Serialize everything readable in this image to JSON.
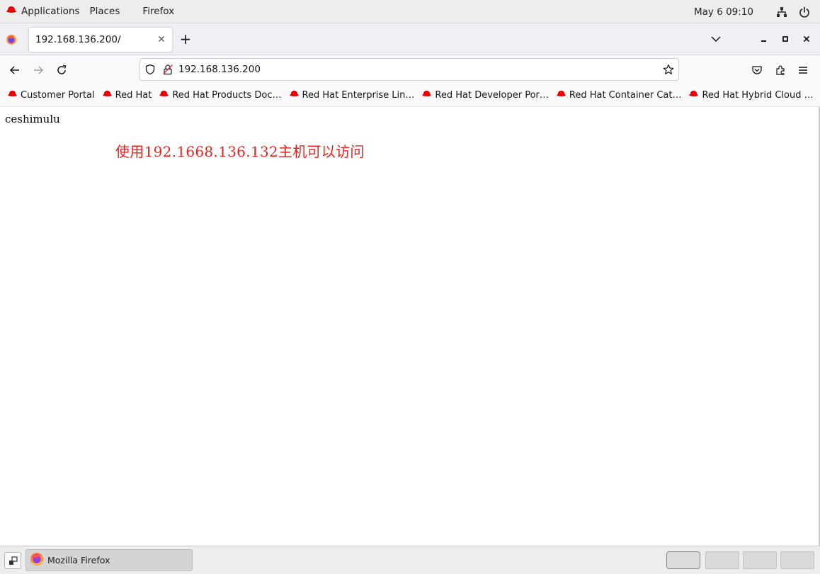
{
  "top_panel": {
    "applications": "Applications",
    "places": "Places",
    "app_name": "Firefox",
    "clock": "May 6  09:10"
  },
  "tabs": [
    {
      "title": "192.168.136.200/"
    }
  ],
  "navbar": {
    "url": "192.168.136.200"
  },
  "bookmarks": [
    {
      "label": "Customer Portal"
    },
    {
      "label": "Red Hat"
    },
    {
      "label": "Red Hat Products Doc…"
    },
    {
      "label": "Red Hat Enterprise Lin…"
    },
    {
      "label": "Red Hat Developer Por…"
    },
    {
      "label": "Red Hat Container Cat…"
    },
    {
      "label": "Red Hat Hybrid Cloud …"
    }
  ],
  "page": {
    "body_text": "ceshimulu",
    "annotation": "使用192.1668.136.132主机可以访问",
    "annotation_color": "#e8231f"
  },
  "taskbar": {
    "window_label": "Mozilla Firefox",
    "workspaces": 4,
    "active_workspace": 1
  },
  "icons": {
    "redhat": "redhat-icon",
    "firefox": "firefox-icon",
    "network": "network-icon",
    "power": "power-icon"
  },
  "colors": {
    "redhat_red": "#ee0000",
    "panel_bg": "#ededed",
    "toolbar_bg": "#f9f9fb"
  }
}
